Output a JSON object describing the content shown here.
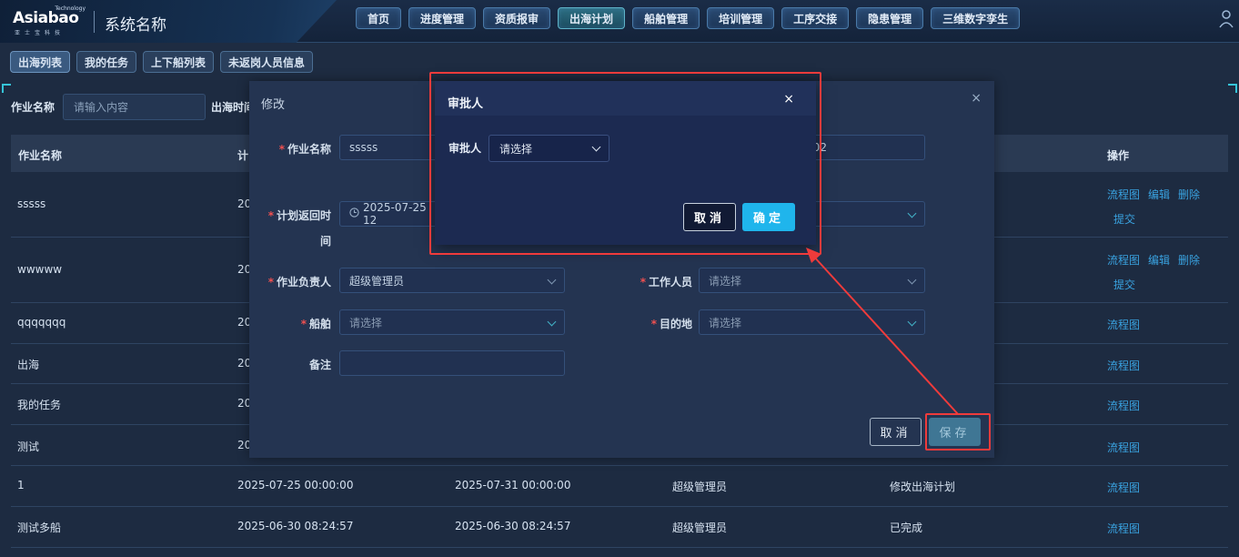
{
  "header": {
    "logo_text": "Asiabao",
    "logo_tag": "Technology",
    "logo_sub": "亚士宝科技",
    "system_name": "系统名称",
    "nav": [
      {
        "label": "首页",
        "active": false
      },
      {
        "label": "进度管理",
        "active": false
      },
      {
        "label": "资质报审",
        "active": false
      },
      {
        "label": "出海计划",
        "active": true
      },
      {
        "label": "船舶管理",
        "active": false
      },
      {
        "label": "培训管理",
        "active": false
      },
      {
        "label": "工序交接",
        "active": false
      },
      {
        "label": "隐患管理",
        "active": false
      },
      {
        "label": "三维数字孪生",
        "active": false
      }
    ]
  },
  "subtabs": [
    {
      "label": "出海列表",
      "active": true
    },
    {
      "label": "我的任务",
      "active": false
    },
    {
      "label": "上下船列表",
      "active": false
    },
    {
      "label": "未返岗人员信息",
      "active": false
    }
  ],
  "search": {
    "label": "作业名称",
    "placeholder": "请输入内容",
    "label2": "出海时间"
  },
  "table": {
    "headers": [
      "作业名称",
      "计",
      "操作"
    ],
    "rows": [
      {
        "name": "sssss",
        "c2": "20",
        "c3": "",
        "c4": "",
        "c5": "",
        "ops": [
          "流程图",
          "编辑",
          "删除",
          "提交"
        ]
      },
      {
        "name": "wwwww",
        "c2": "20",
        "c3": "",
        "c4": "",
        "c5": "",
        "ops": [
          "流程图",
          "编辑",
          "删除",
          "提交"
        ]
      },
      {
        "name": "qqqqqqq",
        "c2": "20",
        "c3": "",
        "c4": "",
        "c5": "",
        "ops": [
          "流程图"
        ]
      },
      {
        "name": "出海",
        "c2": "20",
        "c3": "",
        "c4": "",
        "c5": "",
        "ops": [
          "流程图"
        ]
      },
      {
        "name": "我的任务",
        "c2": "20",
        "c3": "",
        "c4": "",
        "c5": "",
        "ops": [
          "流程图"
        ]
      },
      {
        "name": "测试",
        "c2": "20",
        "c3": "",
        "c4": "",
        "c5": "",
        "ops": [
          "流程图"
        ]
      },
      {
        "name": "1",
        "c2": "2025-07-25 00:00:00",
        "c3": "2025-07-31 00:00:00",
        "c4": "超级管理员",
        "c5": "修改出海计划",
        "ops": [
          "流程图"
        ]
      },
      {
        "name": "测试多船",
        "c2": "2025-06-30 08:24:57",
        "c3": "2025-06-30 08:24:57",
        "c4": "超级管理员",
        "c5": "已完成",
        "ops": [
          "流程图"
        ]
      }
    ]
  },
  "edit_dialog": {
    "title": "修改",
    "close": "×",
    "fields": {
      "job_name_label": "作业名称",
      "job_name_value": "sssss",
      "right_time_partial": "2:02",
      "return_time_label_1": "计划返回时",
      "return_time_label_2": "间",
      "return_time_value": "2025-07-25 12",
      "leader_label": "作业负责人",
      "leader_value": "超级管理员",
      "worker_label": "工作人员",
      "worker_placeholder": "请选择",
      "ship_label": "船舶",
      "ship_placeholder": "请选择",
      "dest_label": "目的地",
      "dest_placeholder": "请选择",
      "remark_label": "备注"
    },
    "cancel_label": "取消",
    "save_label": "保存"
  },
  "approver_dialog": {
    "title": "审批人",
    "close": "×",
    "label": "审批人",
    "select_value": "请选择",
    "cancel_label": "取消",
    "ok_label": "确定"
  },
  "annotation_color": "#ef3b3b"
}
